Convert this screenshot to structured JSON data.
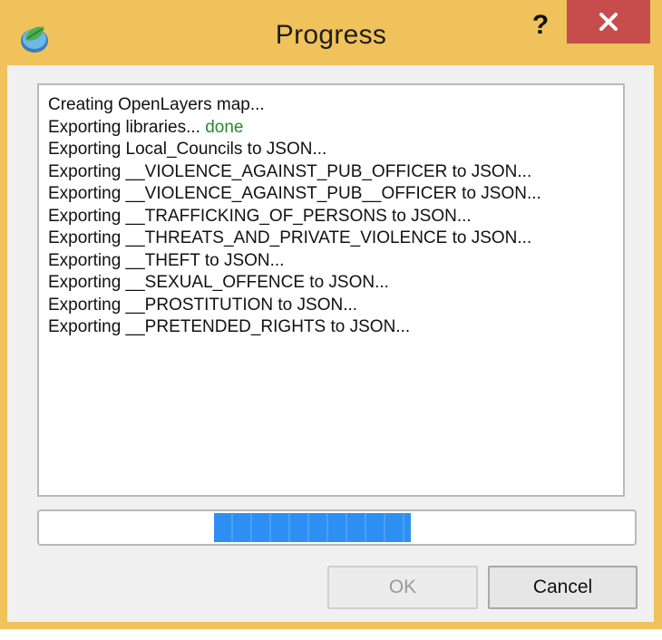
{
  "window": {
    "title": "Progress",
    "help_label": "?",
    "accent_color": "#f0c25b",
    "close_color": "#c74d4d"
  },
  "log": {
    "lines": [
      {
        "text": "Creating OpenLayers map...",
        "suffix": ""
      },
      {
        "text": "Exporting libraries... ",
        "suffix": "done"
      },
      {
        "text": "Exporting Local_Councils to JSON...",
        "suffix": ""
      },
      {
        "text": "Exporting __VIOLENCE_AGAINST_PUB_OFFICER to JSON...",
        "suffix": ""
      },
      {
        "text": "Exporting __VIOLENCE_AGAINST_PUB__OFFICER to JSON...",
        "suffix": ""
      },
      {
        "text": "Exporting __TRAFFICKING_OF_PERSONS to JSON...",
        "suffix": ""
      },
      {
        "text": "Exporting __THREATS_AND_PRIVATE_VIOLENCE to JSON...",
        "suffix": ""
      },
      {
        "text": "Exporting __THEFT to JSON...",
        "suffix": ""
      },
      {
        "text": "Exporting __SEXUAL_OFFENCE to JSON...",
        "suffix": ""
      },
      {
        "text": "Exporting __PROSTITUTION to JSON...",
        "suffix": ""
      },
      {
        "text": "Exporting __PRETENDED_RIGHTS to JSON...",
        "suffix": ""
      }
    ],
    "done_color": "#2a8a2a"
  },
  "progress": {
    "mode": "indeterminate",
    "fill_color": "#2d8ff2"
  },
  "buttons": {
    "ok_label": "OK",
    "ok_enabled": false,
    "cancel_label": "Cancel"
  }
}
